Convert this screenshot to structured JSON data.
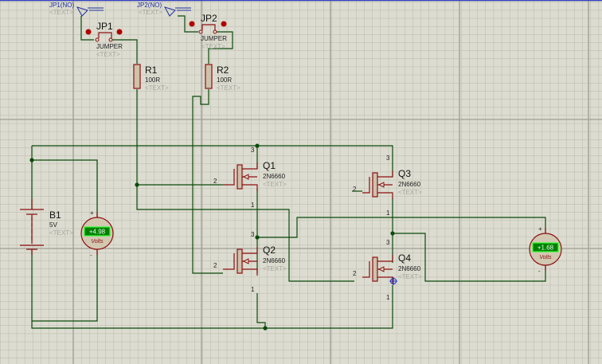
{
  "colors": {
    "wire": "#0b4a0b",
    "component": "#8b1010",
    "background": "#dcdcd0",
    "display": "#008000"
  },
  "terminals": [
    {
      "label": "JP1(NO)",
      "text": "<TEXT>",
      "icon": "terminal-antenna-icon"
    },
    {
      "label": "JP2(NO)",
      "text": "<TEXT>",
      "icon": "terminal-antenna-icon"
    }
  ],
  "jumpers": [
    {
      "ref": "JP1",
      "value": "JUMPER",
      "text": "<TEXT>"
    },
    {
      "ref": "JP2",
      "value": "JUMPER",
      "text": "<TEXT>"
    }
  ],
  "resistors": [
    {
      "ref": "R1",
      "value": "100R",
      "text": "<TEXT>"
    },
    {
      "ref": "R2",
      "value": "100R",
      "text": "<TEXT>"
    }
  ],
  "battery": {
    "ref": "B1",
    "value": "5V",
    "text": "<TEXT>"
  },
  "mosfets": [
    {
      "ref": "Q1",
      "value": "2N6660",
      "text": "<TEXT>",
      "pins": [
        "3",
        "2",
        "1"
      ]
    },
    {
      "ref": "Q2",
      "value": "2N6660",
      "text": "<TEXT>",
      "pins": [
        "3",
        "2",
        "1"
      ]
    },
    {
      "ref": "Q3",
      "value": "2N6660",
      "text": "<TEXT>",
      "pins": [
        "3",
        "2",
        "1"
      ]
    },
    {
      "ref": "Q4",
      "value": "2N6660",
      "text": "<TEXT>",
      "pins": [
        "3",
        "2",
        "1"
      ]
    }
  ],
  "voltmeters": [
    {
      "reading": "+4.98",
      "unit": "Volts",
      "plus": "+",
      "minus": "-"
    },
    {
      "reading": "+1.68",
      "unit": "Volts",
      "plus": "+",
      "minus": "-"
    }
  ]
}
